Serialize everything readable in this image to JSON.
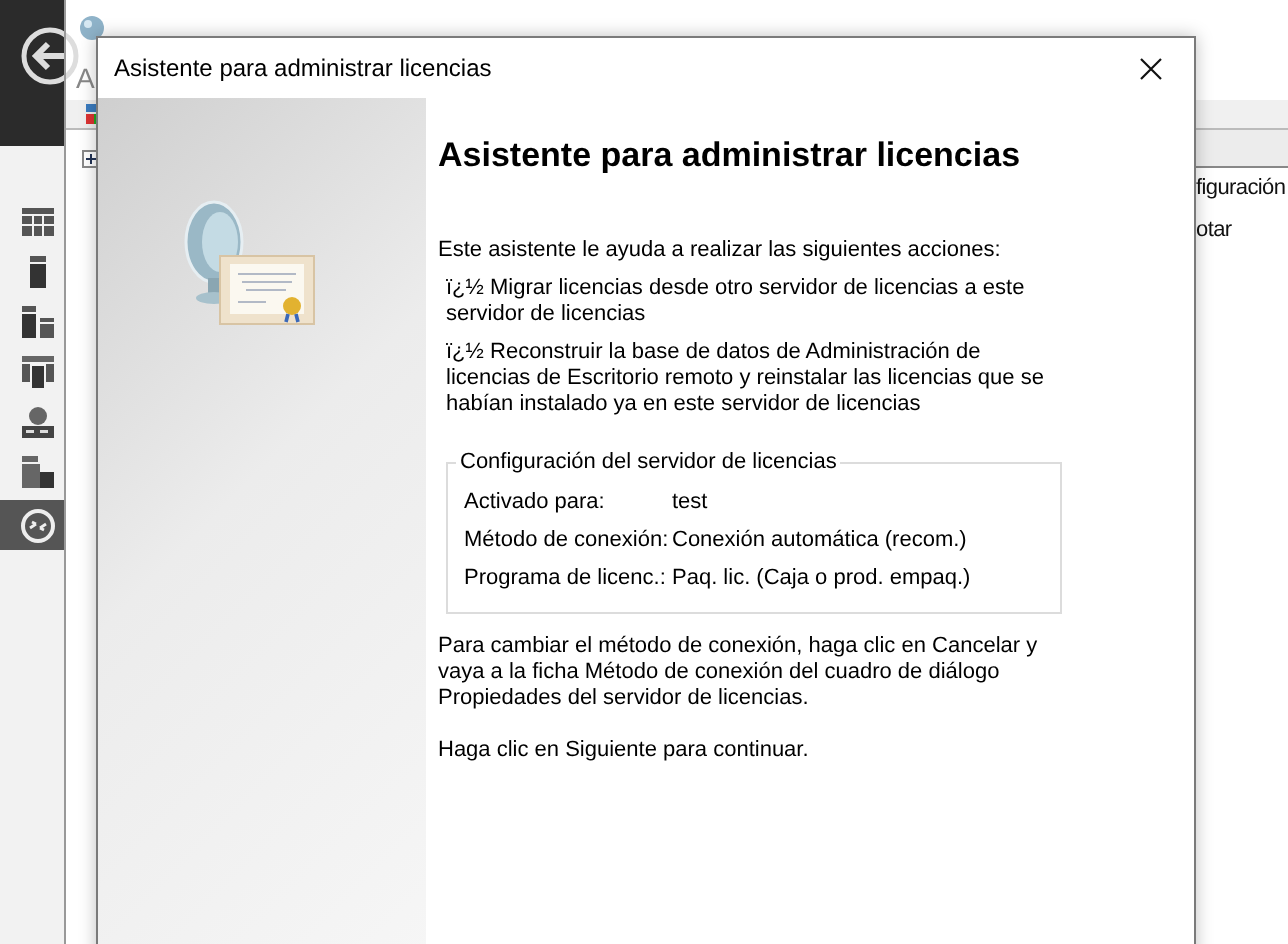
{
  "background_window": {
    "menu_text": "A",
    "pane_items": [
      "figuración",
      "otar"
    ]
  },
  "sidebar": {
    "items": [
      {
        "selected": false
      },
      {
        "selected": false
      },
      {
        "selected": false
      },
      {
        "selected": false
      },
      {
        "selected": false
      },
      {
        "selected": false
      },
      {
        "selected": true
      }
    ]
  },
  "dialog": {
    "title": "Asistente para administrar licencias",
    "heading": "Asistente para administrar licencias",
    "intro": "Este asistente le ayuda a realizar las siguientes acciones:",
    "actions": [
      "ï¿½ Migrar licencias desde otro servidor de licencias a este servidor de licencias",
      "ï¿½ Reconstruir la base de datos de Administración de licencias de Escritorio remoto y reinstalar las licencias que se habían instalado ya en este servidor de licencias"
    ],
    "config": {
      "legend": "Configuración del servidor de licencias",
      "rows": [
        {
          "label": "Activado para:",
          "value": "test"
        },
        {
          "label": "Método de conexión:",
          "value": "Conexión automática (recom.)"
        },
        {
          "label": "Programa de licenc.:",
          "value": "Paq. lic. (Caja o prod. empaq.)"
        }
      ]
    },
    "note": "Para cambiar el método de conexión, haga clic en Cancelar y vaya a la ficha Método de conexión del cuadro de diálogo Propiedades del servidor de licencias.",
    "continue": "Haga clic en Siguiente para continuar."
  }
}
